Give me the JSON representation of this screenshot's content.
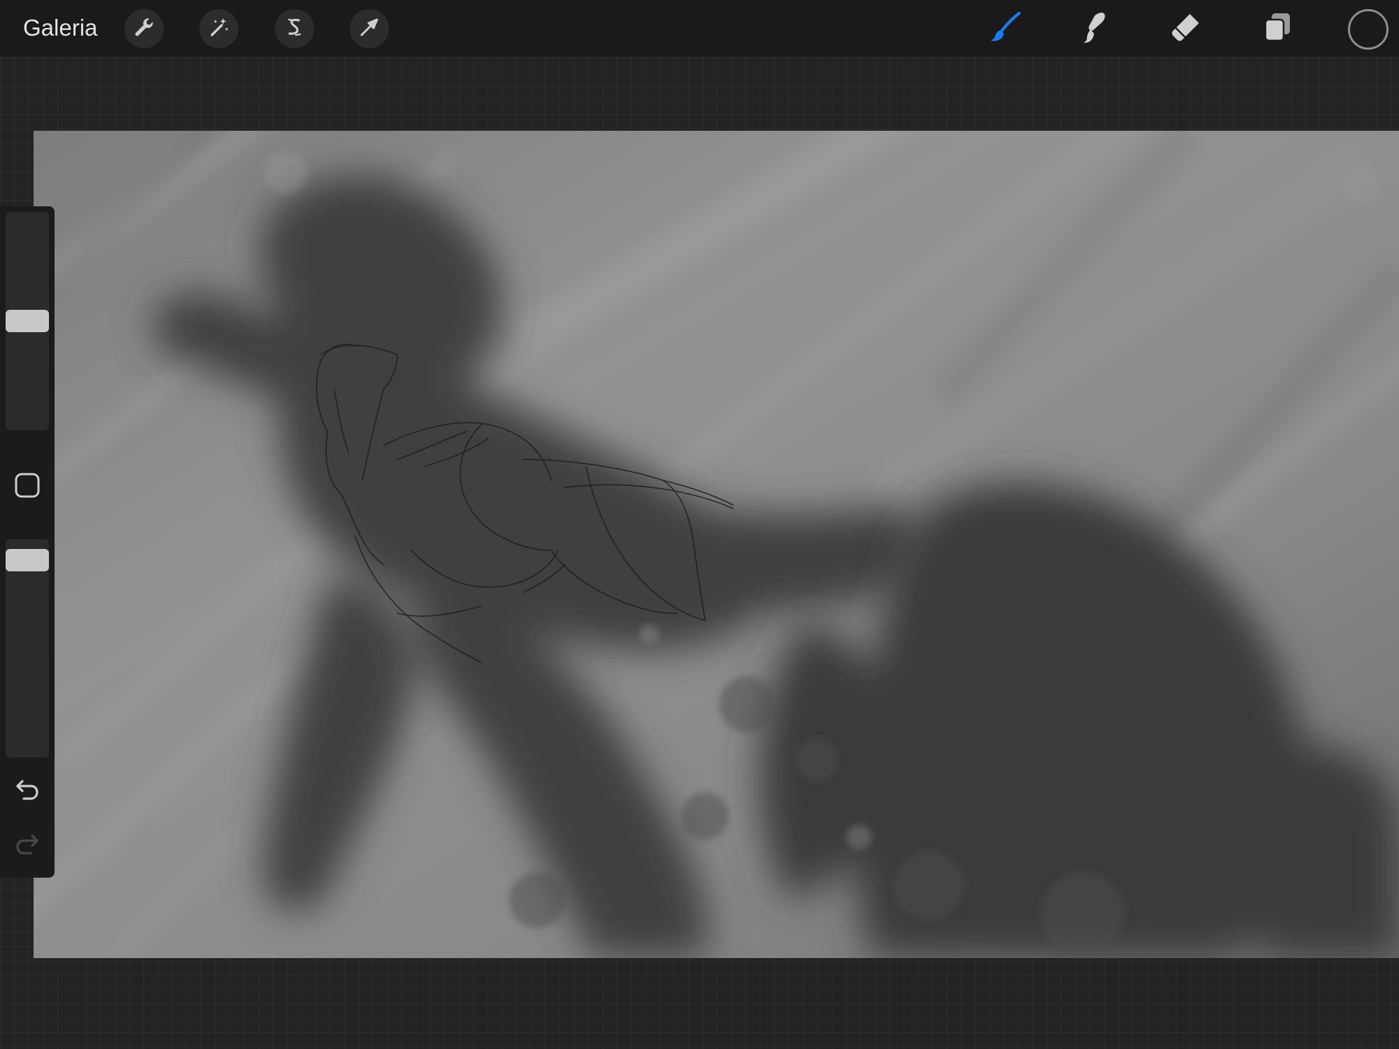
{
  "toolbar": {
    "gallery_label": "Galeria",
    "left_tools": [
      {
        "name": "actions",
        "icon": "wrench-icon"
      },
      {
        "name": "adjustments",
        "icon": "magic-wand-icon"
      },
      {
        "name": "selection",
        "icon": "selection-s-icon"
      },
      {
        "name": "transform",
        "icon": "arrow-cursor-icon"
      }
    ],
    "right_tools": [
      {
        "name": "brush",
        "icon": "brush-icon",
        "active": true
      },
      {
        "name": "smudge",
        "icon": "smudge-icon",
        "active": false
      },
      {
        "name": "eraser",
        "icon": "eraser-icon",
        "active": false
      },
      {
        "name": "layers",
        "icon": "layers-icon",
        "active": false
      }
    ],
    "current_color": "#1a1a1b",
    "active_color": "#1a7cf5"
  },
  "sidebar": {
    "brush_size_level": 0.5,
    "brush_opacity_level": 0.95,
    "modify_icon": "square-icon",
    "undo_icon": "undo-icon",
    "redo_icon": "redo-icon",
    "redo_enabled": false
  },
  "canvas": {
    "description_icon": "artwork-canvas"
  }
}
